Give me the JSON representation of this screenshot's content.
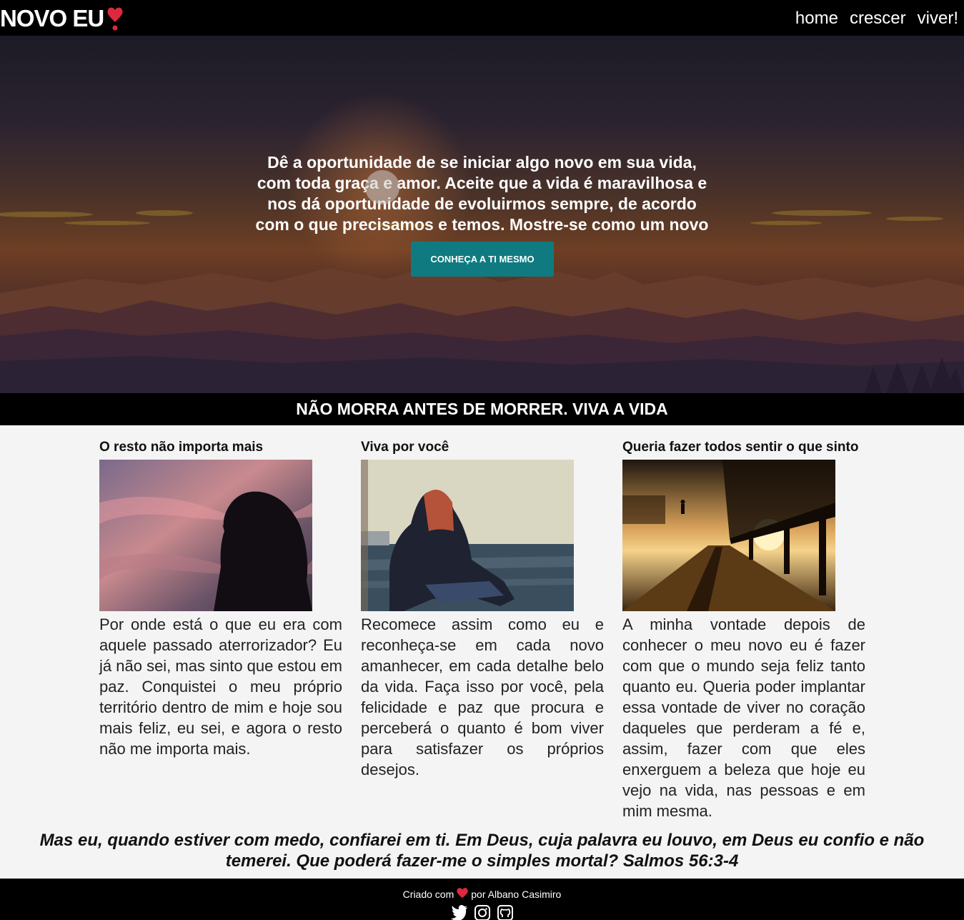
{
  "nav": {
    "brand": "NOVO EU",
    "links": [
      "home",
      "crescer",
      "viver!"
    ]
  },
  "hero": {
    "text": "Dê a oportunidade de se iniciar algo novo em sua vida, com toda graça e amor. Aceite que a vida é maravilhosa e nos dá oportunidade de evoluirmos sempre, de acordo com o que precisamos e temos. Mostre-se como um novo ser.",
    "button": "CONHEÇA A TI MESMO"
  },
  "banner": "NÃO MORRA ANTES DE MORRER. VIVA A VIDA",
  "columns": [
    {
      "title": "O resto não importa mais",
      "text": "Por onde está o que eu era com aquele passado aterrorizador? Eu já não sei, mas sinto que estou em paz. Conquistei o meu próprio território dentro de mim e hoje sou mais feliz, eu sei, e agora o resto não me importa mais."
    },
    {
      "title": "Viva por você",
      "text": "Recomece assim como eu e reconheça-se em cada novo amanhecer, em cada detalhe belo da vida. Faça isso por você, pela felicidade e paz que procura e perceberá o quanto é bom viver para satisfazer os próprios desejos."
    },
    {
      "title": "Queria fazer todos sentir o que sinto",
      "text": "A minha vontade depois de conhecer o meu novo eu é fazer com que o mundo seja feliz tanto quanto eu. Queria poder implantar essa vontade de viver no coração daqueles que perderam a fé e, assim, fazer com que eles enxerguem a beleza que hoje eu vejo na vida, nas pessoas e em mim mesma."
    }
  ],
  "quote": "Mas eu, quando estiver com medo, confiarei em ti. Em Deus, cuja palavra eu louvo, em Deus eu confio e não temerei. Que poderá fazer-me o simples mortal? Salmos 56:3-4",
  "footer": {
    "created": "Criado com",
    "by": "por Albano Casimiro",
    "icons": [
      "twitter-icon",
      "instagram-icon",
      "github-icon"
    ]
  },
  "colors": {
    "accent": "#0f7b80",
    "heart": "#e0283c"
  }
}
